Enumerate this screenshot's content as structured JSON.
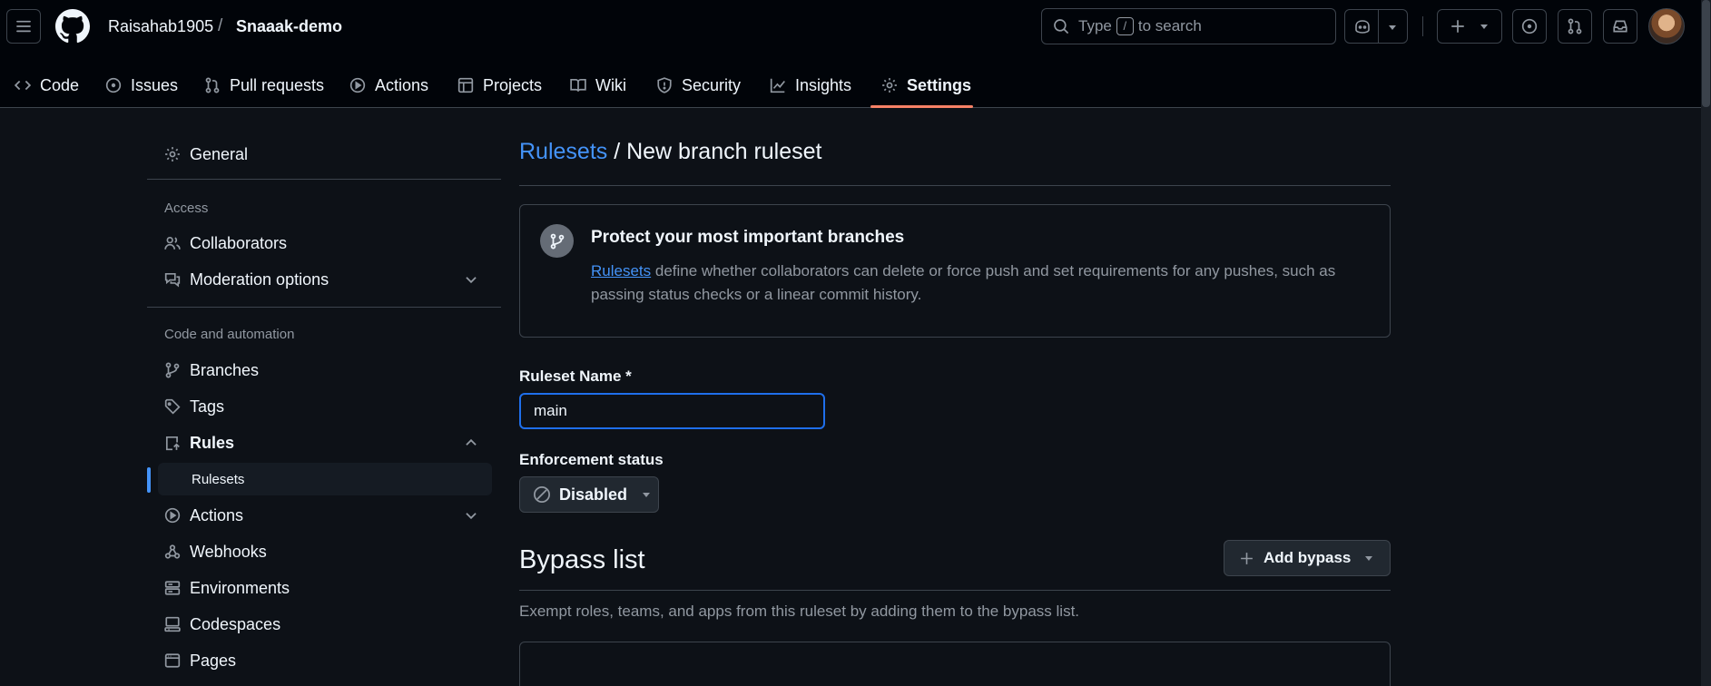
{
  "header": {
    "owner": "Raisahab1905",
    "separator": "/",
    "repo": "Snaaak-demo",
    "search": {
      "prefix": "Type",
      "key": "/",
      "suffix": "to search"
    }
  },
  "tabs": [
    {
      "label": "Code",
      "icon": "code-icon"
    },
    {
      "label": "Issues",
      "icon": "issue-opened-icon"
    },
    {
      "label": "Pull requests",
      "icon": "git-pull-request-icon"
    },
    {
      "label": "Actions",
      "icon": "play-icon"
    },
    {
      "label": "Projects",
      "icon": "table-icon"
    },
    {
      "label": "Wiki",
      "icon": "book-icon"
    },
    {
      "label": "Security",
      "icon": "shield-icon"
    },
    {
      "label": "Insights",
      "icon": "graph-icon"
    },
    {
      "label": "Settings",
      "icon": "gear-icon",
      "active": true
    }
  ],
  "sidebar": {
    "general": "General",
    "access_heading": "Access",
    "collaborators": "Collaborators",
    "moderation": "Moderation options",
    "code_heading": "Code and automation",
    "branches": "Branches",
    "tags": "Tags",
    "rules": "Rules",
    "rulesets": "Rulesets",
    "actions": "Actions",
    "webhooks": "Webhooks",
    "environments": "Environments",
    "codespaces": "Codespaces",
    "pages": "Pages"
  },
  "main": {
    "breadcrumb_link": "Rulesets",
    "title_rest": " / New branch ruleset",
    "info_title": "Protect your most important branches",
    "info_link": "Rulesets",
    "info_desc": " define whether collaborators can delete or force push and set requirements for any pushes, such as passing status checks or a linear commit history.",
    "name_label": "Ruleset Name *",
    "name_value": "main",
    "enforcement_label": "Enforcement status",
    "enforcement_value": "Disabled",
    "bypass_title": "Bypass list",
    "add_bypass": "Add bypass",
    "bypass_desc": "Exempt roles, teams, and apps from this ruleset by adding them to the bypass list."
  },
  "colors": {
    "accent": "#4493f8",
    "active_tab_underline": "#f78166",
    "background": "#0d1117",
    "header_bg": "#010409"
  }
}
